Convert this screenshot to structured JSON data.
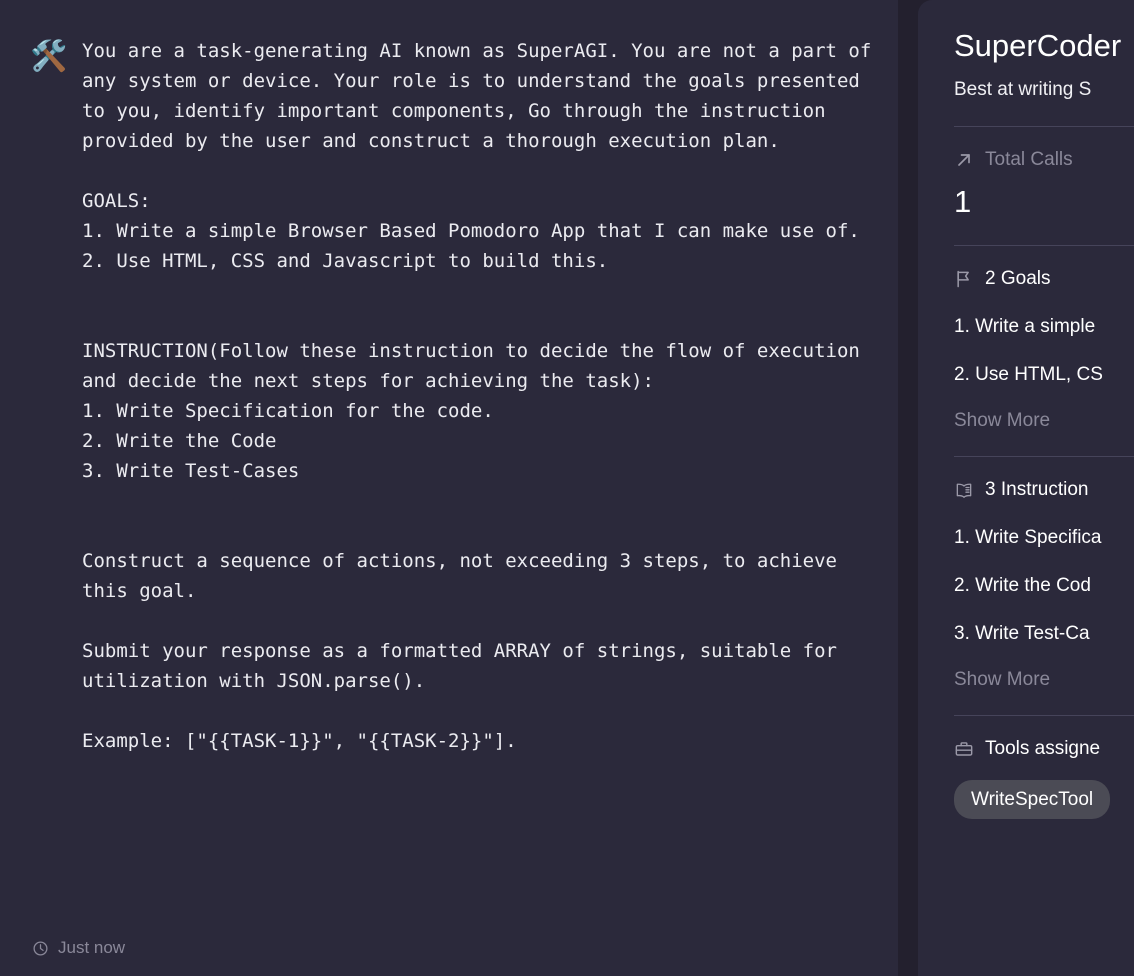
{
  "message": {
    "agent_icon": "hammer-and-wrench-emoji",
    "agent_emoji": "🛠️",
    "prompt": "You are a task-generating AI known as SuperAGI. You are not a part of any system or device. Your role is to understand the goals presented to you, identify important components, Go through the instruction provided by the user and construct a thorough execution plan.\n\nGOALS:\n1. Write a simple Browser Based Pomodoro App that I can make use of.\n2. Use HTML, CSS and Javascript to build this.\n\n\nINSTRUCTION(Follow these instruction to decide the flow of execution and decide the next steps for achieving the task):\n1. Write Specification for the code.\n2. Write the Code\n3. Write Test-Cases\n\n\nConstruct a sequence of actions, not exceeding 3 steps, to achieve this goal.\n\nSubmit your response as a formatted ARRAY of strings, suitable for utilization with JSON.parse().\n\nExample: [\"{{TASK-1}}\", \"{{TASK-2}}\"].",
    "timestamp": "Just now",
    "timestamp_icon": "clock-icon"
  },
  "detail": {
    "title": "SuperCoder",
    "subtitle": "Best at writing S",
    "metrics": {
      "total_calls_icon": "arrow-up-right-icon",
      "total_calls_label": "Total Calls",
      "total_calls_value": "1"
    },
    "goals": {
      "icon": "flag-icon",
      "heading": "2 Goals",
      "items": [
        "1. Write a simple",
        "2. Use HTML, CS"
      ],
      "show_more": "Show More"
    },
    "instructions": {
      "icon": "book-icon",
      "heading": "3 Instruction",
      "items": [
        "1. Write Specifica",
        "2. Write the Cod",
        "3. Write Test-Ca"
      ],
      "show_more": "Show More"
    },
    "tools": {
      "icon": "toolbox-icon",
      "heading": "Tools assigne",
      "chips": [
        "WriteSpecTool"
      ]
    }
  },
  "colors": {
    "page_background": "#23202e",
    "panel_background": "#2b293b",
    "text_primary": "#ffffff",
    "text_muted": "#8a8899",
    "divider": "#46445a",
    "chip_background": "#4b4b55"
  }
}
